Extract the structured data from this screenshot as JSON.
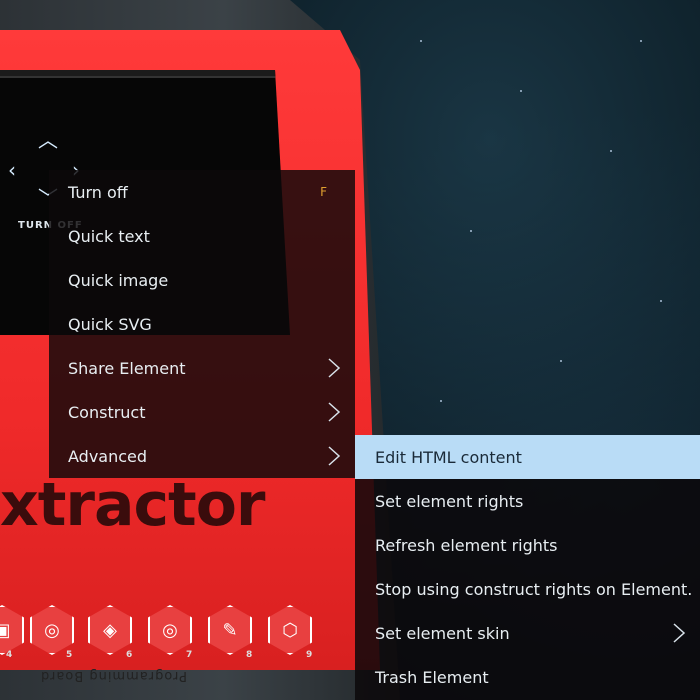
{
  "hud": {
    "dpad_label": "TURN OFF",
    "brand_text": "xtractor",
    "plate_label": "Programming Board"
  },
  "hotbar": {
    "slots": [
      "4",
      "5",
      "6",
      "7",
      "8",
      "9"
    ]
  },
  "context_menu": {
    "items": [
      {
        "label": "Turn off",
        "hotkey": "F"
      },
      {
        "label": "Quick text"
      },
      {
        "label": "Quick image"
      },
      {
        "label": "Quick SVG"
      },
      {
        "label": "Share Element",
        "has_submenu": true
      },
      {
        "label": "Construct",
        "has_submenu": true
      },
      {
        "label": "Advanced",
        "has_submenu": true
      }
    ]
  },
  "advanced_submenu": {
    "items": [
      {
        "label": "Edit HTML content",
        "active": true
      },
      {
        "label": "Set element rights"
      },
      {
        "label": "Refresh element rights"
      },
      {
        "label": "Stop using construct rights on Element."
      },
      {
        "label": "Set element skin",
        "has_submenu": true
      },
      {
        "label": "Trash Element"
      }
    ]
  },
  "colors": {
    "menu_bg": "#0c080a",
    "highlight": "#b9dcf6",
    "hotkey": "#e0a030",
    "panel_red": "#f02a2a"
  }
}
